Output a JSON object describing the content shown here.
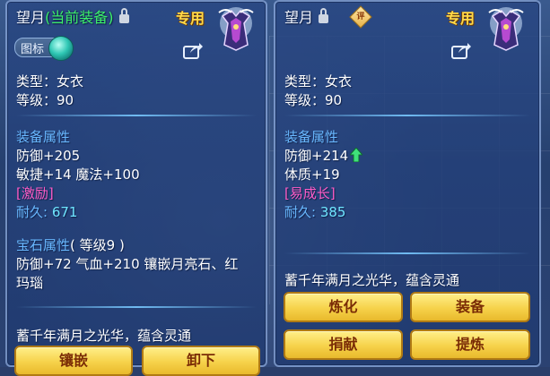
{
  "left": {
    "name": "望月",
    "equipped_tag": "(当前装备)",
    "exclusive": "专用",
    "badge_label": "图标",
    "type_line": "类型：女衣",
    "level_line": "等级：90",
    "attr_title": "装备属性",
    "attr_lines": [
      "防御+205",
      "敏捷+14 魔法+100"
    ],
    "effect": "[激励]",
    "durability_label": "耐久:",
    "durability_value": "671",
    "gem_title": "宝石属性",
    "gem_level": "( 等级9 )",
    "gem_line1": "防御+72 气血+210 镶嵌月亮石、红",
    "gem_line2": "玛瑙",
    "desc": "蓄千年满月之光华，蕴含灵通",
    "buttons": [
      "镶嵌",
      "卸下"
    ]
  },
  "right": {
    "name": "望月",
    "appraise_label": "评",
    "exclusive": "专用",
    "type_line": "类型：女衣",
    "level_line": "等级：90",
    "attr_title": "装备属性",
    "attr_line1": "防御+214",
    "attr_line2": "体质+19",
    "effect": "[易成长]",
    "durability_label": "耐久:",
    "durability_value": "385",
    "desc": "蓄千年满月之光华，蕴含灵通",
    "buttons": [
      "炼化",
      "装备",
      "捐献",
      "提炼"
    ]
  },
  "colors": {
    "text": "#ffffff",
    "section": "#69b8ff",
    "effect": "#ff5cc6",
    "equipped": "#3df06a",
    "exclusive": "#ffd94a",
    "button": "#f6d24a",
    "button_text": "#7a2c06"
  },
  "icons": [
    "lock-icon",
    "appraise-icon",
    "share-icon",
    "arrow-up-icon",
    "item-armor-icon"
  ]
}
